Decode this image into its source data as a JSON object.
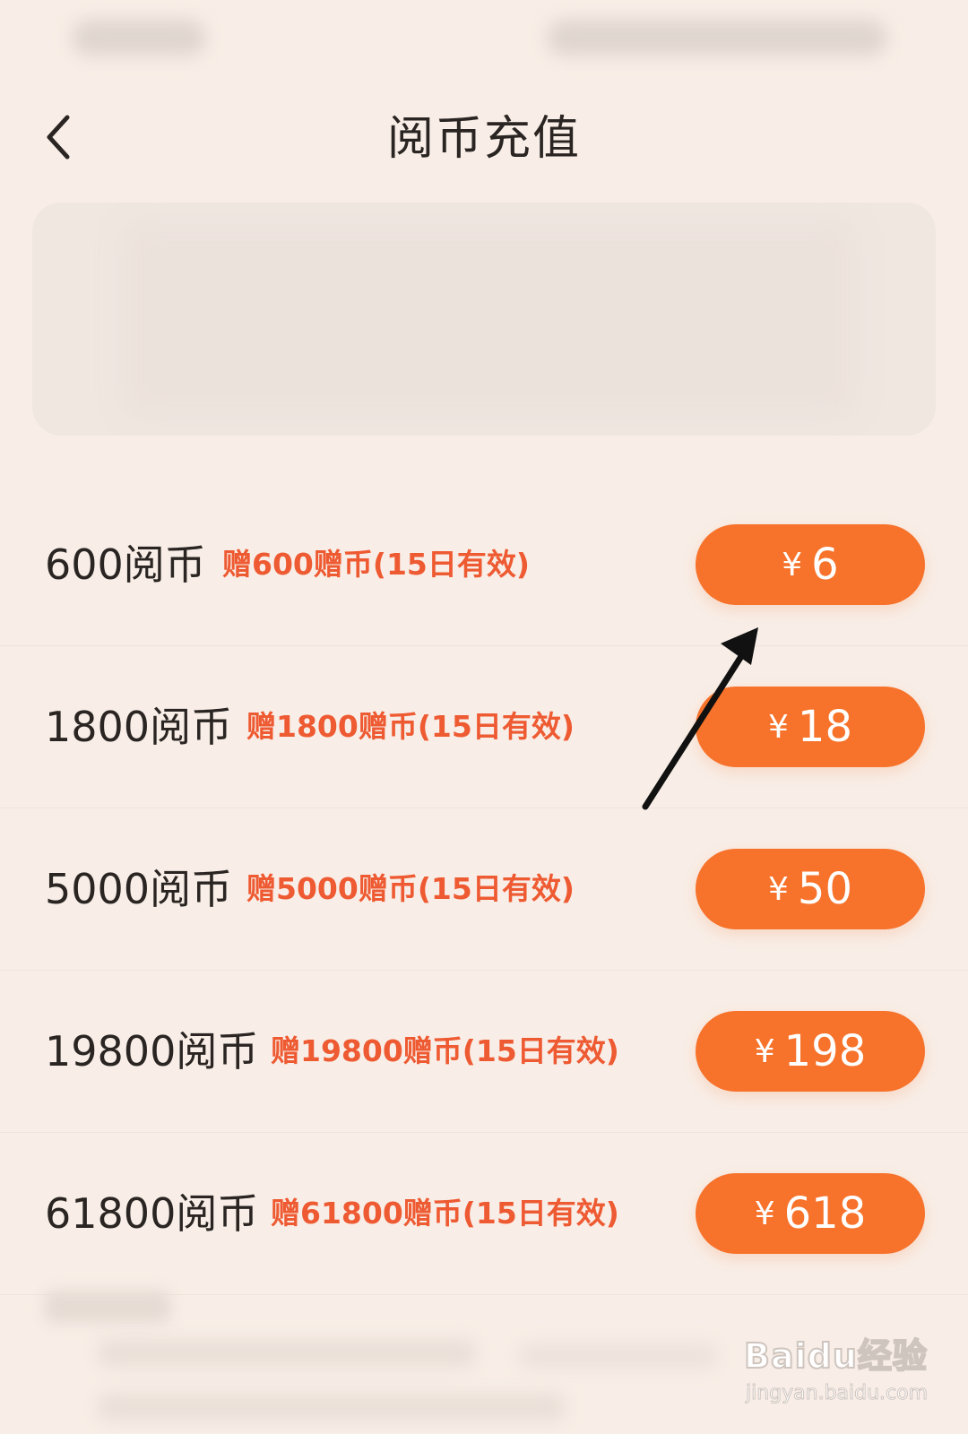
{
  "header": {
    "title": "阅币充值"
  },
  "packages": [
    {
      "name": "600阅币",
      "bonus": "赠600赠币(15日有效)",
      "currency": "¥",
      "price": "6"
    },
    {
      "name": "1800阅币",
      "bonus": "赠1800赠币(15日有效)",
      "currency": "¥",
      "price": "18"
    },
    {
      "name": "5000阅币",
      "bonus": "赠5000赠币(15日有效)",
      "currency": "¥",
      "price": "50"
    },
    {
      "name": "19800阅币",
      "bonus": "赠19800赠币(15日有效)",
      "currency": "¥",
      "price": "198"
    },
    {
      "name": "61800阅币",
      "bonus": "赠61800赠币(15日有效)",
      "currency": "¥",
      "price": "618"
    }
  ],
  "watermark": {
    "brand": "Baidu经验",
    "url": "jingyan.baidu.com"
  },
  "colors": {
    "background": "#f8eee7",
    "accent": "#f7722a",
    "bonus_text": "#ee5a32"
  },
  "icons": {
    "back": "chevron-left-icon",
    "annotation": "arrow-annotation-icon"
  }
}
